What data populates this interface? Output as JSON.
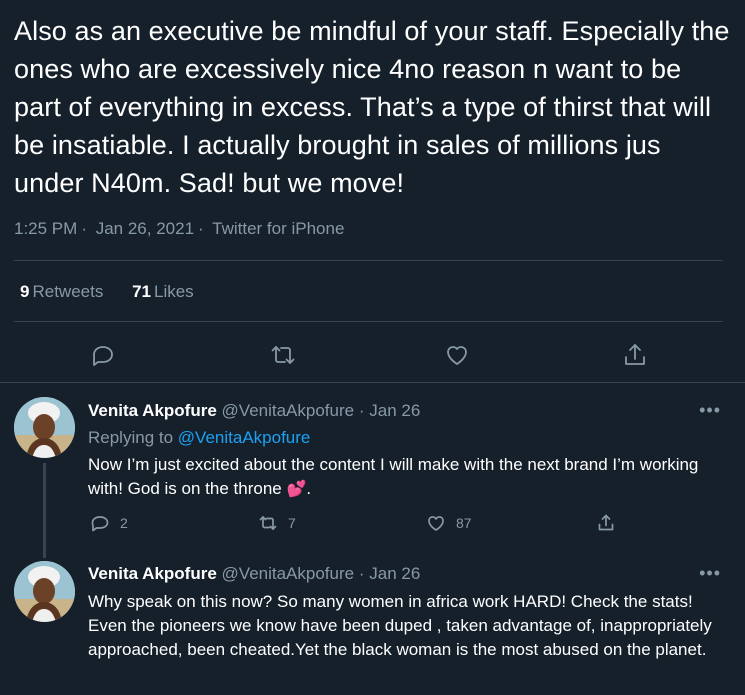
{
  "tweet": {
    "text": "Also as an executive be mindful of your staff. Especially the ones who are excessively nice 4no reason n want to be part of everything in excess. That’s a type of thirst that will be insatiable. I actually brought in sales of millions jus under N40m. Sad! but we move!",
    "time": "1:25 PM",
    "date": "Jan 26, 2021",
    "source": "Twitter for iPhone",
    "retweets_count": "9",
    "retweets_label": "Retweets",
    "likes_count": "71",
    "likes_label": "Likes",
    "actions": [
      "reply-icon",
      "retweet-icon",
      "like-icon",
      "share-icon"
    ]
  },
  "replies": [
    {
      "name": "Venita Akpofure",
      "handle": "@VenitaAkpofure",
      "date": "Jan 26",
      "replying_prefix": "Replying to",
      "replying_to": "@VenitaAkpofure",
      "text": "Now I’m just excited about the content I will make with the next brand I’m working with! God is on the throne ",
      "emoji": "💕",
      "text_end": ".",
      "reply_count": "2",
      "retweet_count": "7",
      "like_count": "87",
      "more": "•••"
    },
    {
      "name": "Venita Akpofure",
      "handle": "@VenitaAkpofure",
      "date": "Jan 26",
      "text": "Why speak on this now? So many women in africa work HARD! Check the stats! Even the pioneers we know have been duped , taken advantage of, inappropriately approached, been cheated.Yet the black woman is the most abused on the planet.",
      "more": "•••"
    }
  ],
  "separator": "·",
  "colors": {
    "background": "#15202b",
    "text": "#ffffff",
    "muted": "#8899a6",
    "link": "#1da1f2",
    "border": "#38444d"
  }
}
